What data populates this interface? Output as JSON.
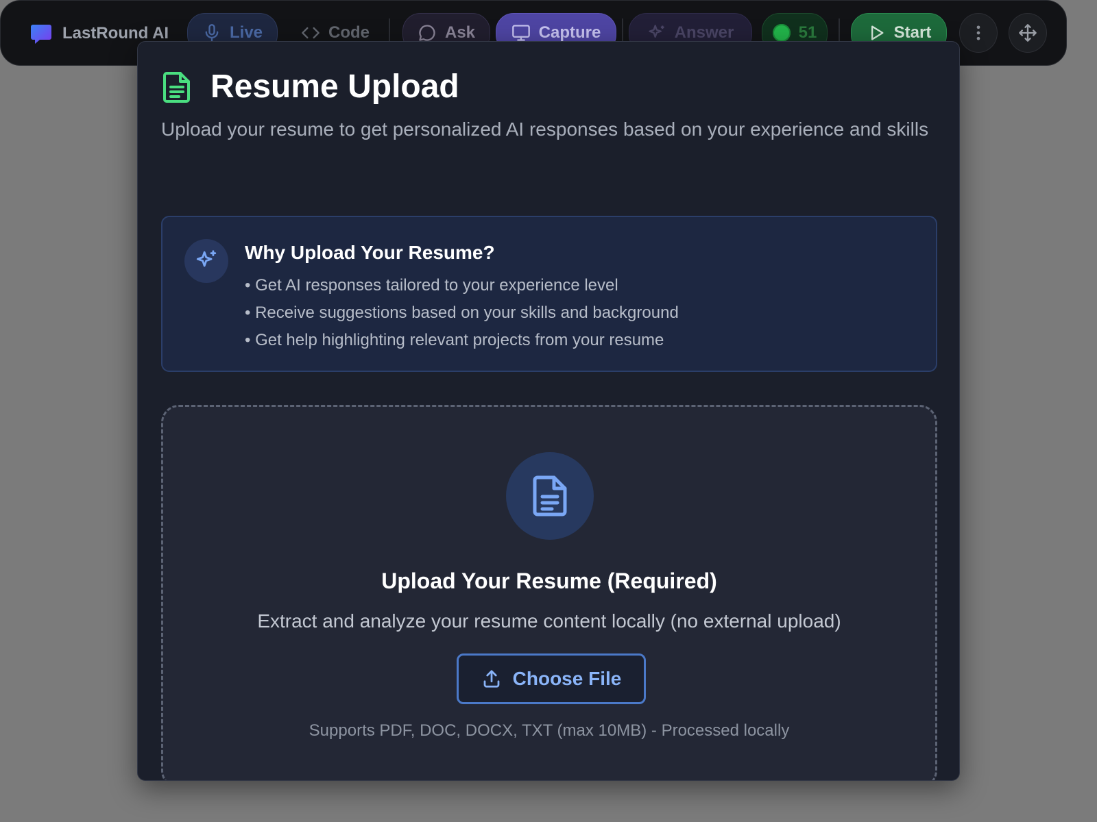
{
  "toolbar": {
    "brand": "LastRound AI",
    "live": "Live",
    "code": "Code",
    "ask": "Ask",
    "capture": "Capture",
    "answer": "Answer",
    "credits": "51",
    "start": "Start",
    "icons": {
      "brand": "chat-bubble-logo",
      "live": "microphone-icon",
      "code": "code-brackets-icon",
      "ask": "chat-bubble-icon",
      "capture": "monitor-icon",
      "answer": "sparkles-icon",
      "credits": "green-dot",
      "start": "play-icon",
      "more": "vertical-dots-icon",
      "move": "move-arrows-icon"
    }
  },
  "modal": {
    "title": "Resume Upload",
    "subtitle": "Upload your resume to get personalized AI responses based on your experience and skills",
    "why": {
      "title": "Why Upload Your Resume?",
      "items": [
        "Get AI responses tailored to your experience level",
        "Receive suggestions based on your skills and background",
        "Get help highlighting relevant projects from your resume"
      ]
    },
    "upload": {
      "title": "Upload Your Resume (Required)",
      "description": "Extract and analyze your resume content locally (no external upload)",
      "button": "Choose File",
      "note": "Supports PDF, DOC, DOCX, TXT (max 10MB) - Processed locally"
    }
  },
  "colors": {
    "background": "#7b7b7b",
    "modal_bg": "#1b1f2b",
    "accent_blue": "#8ab4f8",
    "accent_green": "#4ade80",
    "capture_purple": "#4e45a3",
    "start_green": "#1d6a3b"
  }
}
